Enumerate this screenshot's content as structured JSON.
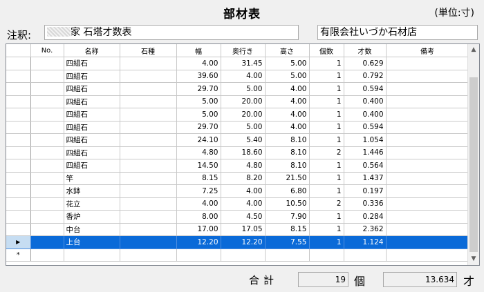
{
  "window": {
    "title": "部材表",
    "unit": "(単位:寸)"
  },
  "note": {
    "label": "注釈:",
    "value": "家 石塔才数表"
  },
  "company": {
    "value": "有限会社いづか石材店"
  },
  "table": {
    "columns": [
      "No.",
      "名称",
      "石種",
      "幅",
      "奥行き",
      "高さ",
      "個数",
      "才数",
      "備考"
    ],
    "rows": [
      {
        "no": "",
        "name": "四組石",
        "stone": "",
        "width": "4.00",
        "depth": "31.45",
        "height": "5.00",
        "count": "1",
        "sai": "0.629",
        "remarks": ""
      },
      {
        "no": "",
        "name": "四組石",
        "stone": "",
        "width": "39.60",
        "depth": "4.00",
        "height": "5.00",
        "count": "1",
        "sai": "0.792",
        "remarks": ""
      },
      {
        "no": "",
        "name": "四組石",
        "stone": "",
        "width": "29.70",
        "depth": "5.00",
        "height": "4.00",
        "count": "1",
        "sai": "0.594",
        "remarks": ""
      },
      {
        "no": "",
        "name": "四組石",
        "stone": "",
        "width": "5.00",
        "depth": "20.00",
        "height": "4.00",
        "count": "1",
        "sai": "0.400",
        "remarks": ""
      },
      {
        "no": "",
        "name": "四組石",
        "stone": "",
        "width": "5.00",
        "depth": "20.00",
        "height": "4.00",
        "count": "1",
        "sai": "0.400",
        "remarks": ""
      },
      {
        "no": "",
        "name": "四組石",
        "stone": "",
        "width": "29.70",
        "depth": "5.00",
        "height": "4.00",
        "count": "1",
        "sai": "0.594",
        "remarks": ""
      },
      {
        "no": "",
        "name": "四組石",
        "stone": "",
        "width": "24.10",
        "depth": "5.40",
        "height": "8.10",
        "count": "1",
        "sai": "1.054",
        "remarks": ""
      },
      {
        "no": "",
        "name": "四組石",
        "stone": "",
        "width": "4.80",
        "depth": "18.60",
        "height": "8.10",
        "count": "2",
        "sai": "1.446",
        "remarks": ""
      },
      {
        "no": "",
        "name": "四組石",
        "stone": "",
        "width": "14.50",
        "depth": "4.80",
        "height": "8.10",
        "count": "1",
        "sai": "0.564",
        "remarks": ""
      },
      {
        "no": "",
        "name": "竿",
        "stone": "",
        "width": "8.15",
        "depth": "8.20",
        "height": "21.50",
        "count": "1",
        "sai": "1.437",
        "remarks": ""
      },
      {
        "no": "",
        "name": "水鉢",
        "stone": "",
        "width": "7.25",
        "depth": "4.00",
        "height": "6.80",
        "count": "1",
        "sai": "0.197",
        "remarks": ""
      },
      {
        "no": "",
        "name": "花立",
        "stone": "",
        "width": "4.00",
        "depth": "4.00",
        "height": "10.50",
        "count": "2",
        "sai": "0.336",
        "remarks": ""
      },
      {
        "no": "",
        "name": "香炉",
        "stone": "",
        "width": "8.00",
        "depth": "4.50",
        "height": "7.90",
        "count": "1",
        "sai": "0.284",
        "remarks": ""
      },
      {
        "no": "",
        "name": "中台",
        "stone": "",
        "width": "17.00",
        "depth": "17.05",
        "height": "8.15",
        "count": "1",
        "sai": "2.362",
        "remarks": ""
      },
      {
        "no": "",
        "name": "上台",
        "stone": "",
        "width": "12.20",
        "depth": "12.20",
        "height": "7.55",
        "count": "1",
        "sai": "1.124",
        "remarks": "",
        "selected": true
      }
    ],
    "new_row_marker": "*",
    "current_row_marker": "▶"
  },
  "totals": {
    "label": "合計",
    "count": "19",
    "count_unit": "個",
    "sai": "13.634",
    "sai_unit": "才"
  },
  "colors": {
    "selection": "#0a6ad8",
    "background": "#f0f0f0"
  },
  "icons": {
    "scroll_up": "chevron-up-icon",
    "scroll_down": "chevron-down-icon",
    "current_row": "triangle-right-icon"
  }
}
